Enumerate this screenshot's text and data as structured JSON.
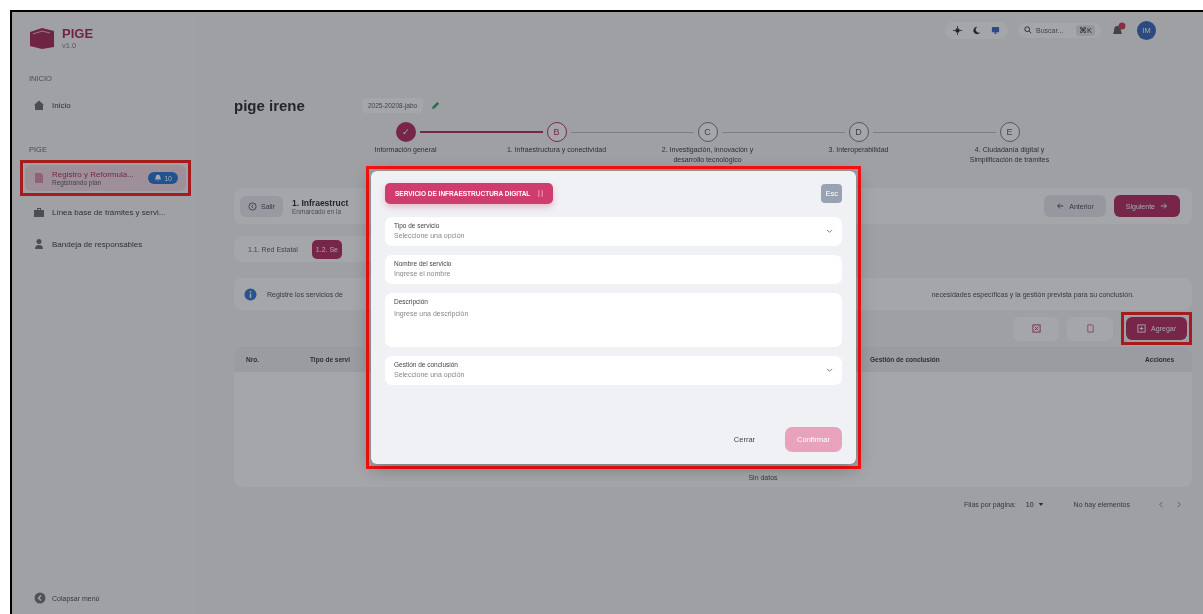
{
  "sidebar": {
    "app_name": "PIGE",
    "version": "v1.0",
    "sections": [
      {
        "heading": "INICIO",
        "items": [
          {
            "label": "Inicio",
            "selected": false,
            "highlighted": false
          }
        ]
      },
      {
        "heading": "PIGE",
        "items": [
          {
            "label": "Registro y Reformula...",
            "sublabel": "Registrando plan",
            "badge": "10",
            "selected": true,
            "highlighted": true
          },
          {
            "label": "Línea base de trámites y servi...",
            "selected": false,
            "highlighted": false
          },
          {
            "label": "Bandeja de responsables",
            "selected": false,
            "highlighted": false
          }
        ]
      }
    ],
    "collapse_label": "Colapsar menú"
  },
  "topbar": {
    "search_placeholder": "Buscar...",
    "shortcut": "⌘K",
    "avatar_initials": "IM"
  },
  "project": {
    "title": "pige irene",
    "code": "2025-20208-jabo"
  },
  "steps": [
    {
      "marker": "✓",
      "label": "Información general",
      "done": true,
      "selected": false
    },
    {
      "marker": "B",
      "label": "1. Infraestructura y conectividad",
      "done": false,
      "selected": true
    },
    {
      "marker": "C",
      "label": "2. Investigación, innovación y desarrollo tecnológico",
      "done": false,
      "selected": false
    },
    {
      "marker": "D",
      "label": "3. Interoperabilidad",
      "done": false,
      "selected": false
    },
    {
      "marker": "E",
      "label": "4. Ciudadanía digital y Simplificación de trámites",
      "done": false,
      "selected": false
    }
  ],
  "section": {
    "exit_label": "Salir",
    "title": "1. Infraestruct",
    "subtitle": "Enmarcado en la",
    "prev_label": "Anterior",
    "next_label": "Siguiente"
  },
  "tabs": [
    {
      "label": "1.1. Red Estatal",
      "selected": false
    },
    {
      "label": "1.2. Se",
      "selected": true
    }
  ],
  "info": {
    "text_start": "Registre los servicios de",
    "text_end": "necesidades específicas y la gestión prevista para su conclusión."
  },
  "toolbar": {
    "add_label": "Agregar",
    "add_highlighted": true
  },
  "table": {
    "columns": [
      "Nro.",
      "Tipo de servi",
      "Gestión de conclusión",
      "Acciones"
    ],
    "empty_text": "Sin datos"
  },
  "pagination": {
    "rows_label": "Filas por página:",
    "rows_value": "10",
    "status": "No hay elementos"
  },
  "modal": {
    "highlighted": true,
    "header": "SERVICIO DE INFRAESTRUCTURA DIGITAL",
    "esc_label": "Esc",
    "fields": [
      {
        "kind": "select",
        "label": "Tipo de servicio",
        "placeholder": "Seleccione una opción"
      },
      {
        "kind": "text",
        "label": "Nombre del servicio",
        "placeholder": "Ingrese el nombre"
      },
      {
        "kind": "textarea",
        "label": "Descripción",
        "placeholder": "Ingrese una descripción"
      },
      {
        "kind": "select",
        "label": "Gestión de conclusión",
        "placeholder": "Seleccione una opción"
      }
    ],
    "cancel_label": "Cerrar",
    "confirm_label": "Confirmar",
    "confirm_disabled": true
  }
}
